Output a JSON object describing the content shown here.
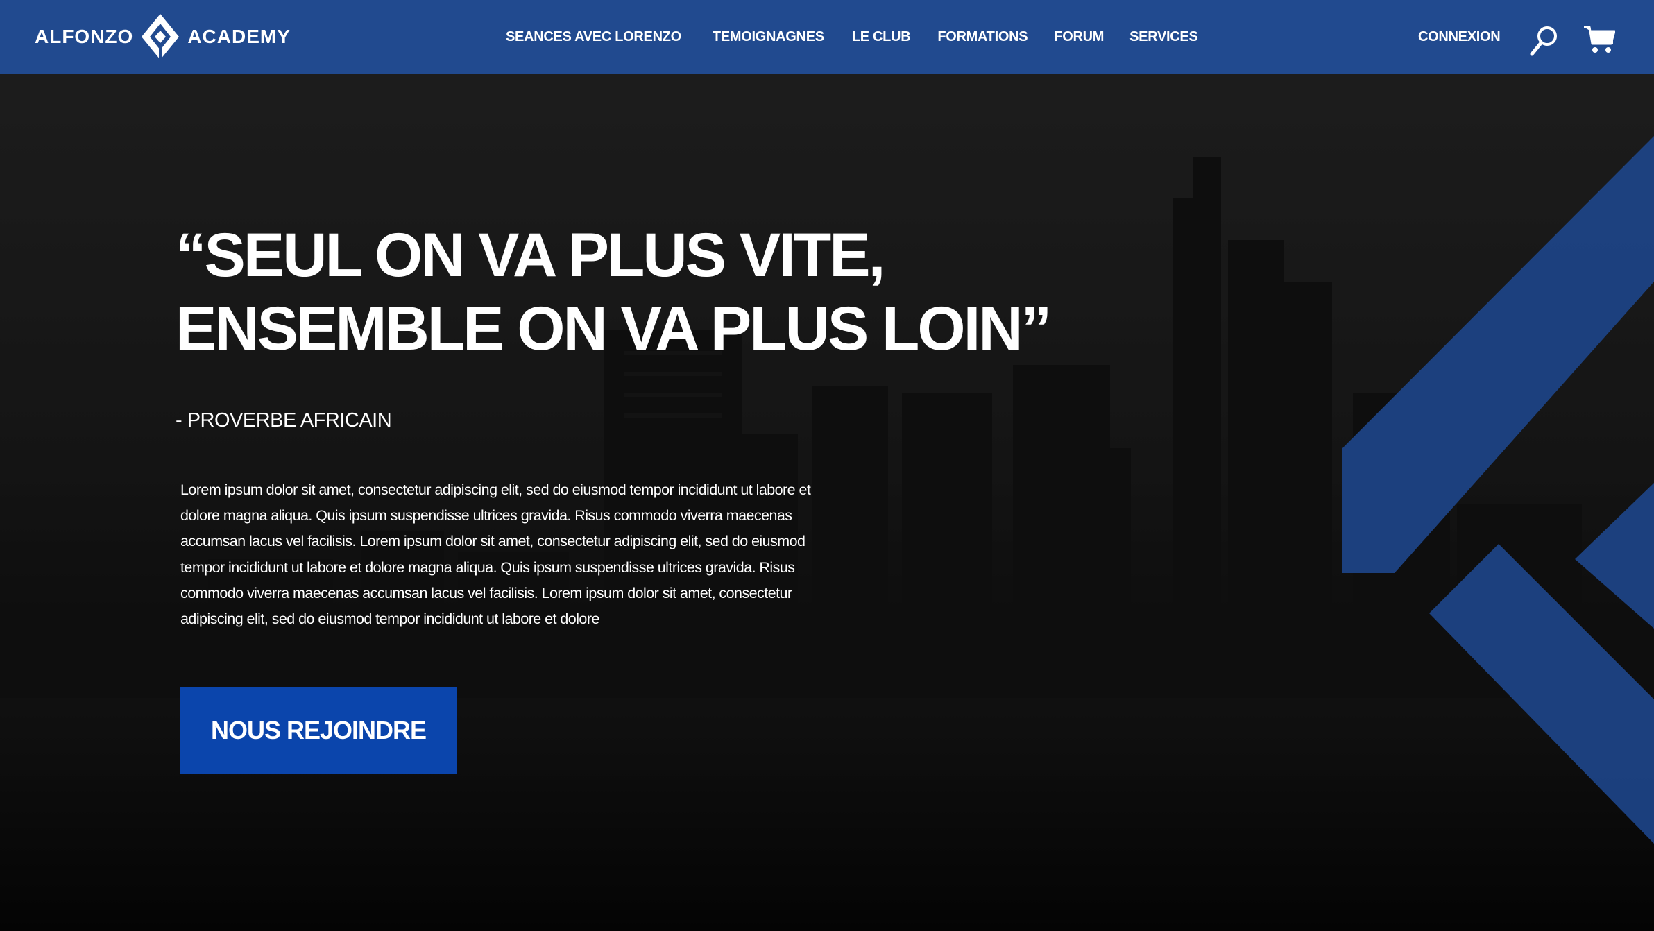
{
  "brand": {
    "name_left": "ALFONZO",
    "name_right": "ACADEMY",
    "logo_icon": "diamond-a-logo-icon"
  },
  "nav": {
    "links": [
      {
        "label": "SEANCES AVEC LORENZO"
      },
      {
        "label": "TEMOIGNAGNES"
      },
      {
        "label": "LE CLUB"
      },
      {
        "label": "FORMATIONS"
      },
      {
        "label": "FORUM"
      },
      {
        "label": "SERVICES"
      }
    ],
    "login_label": "CONNEXION",
    "search_icon": "search-icon",
    "cart_icon": "cart-icon"
  },
  "hero": {
    "quote_line1": "“SEUL ON VA PLUS VITE,",
    "quote_line2": "ENSEMBLE ON VA PLUS LOIN”",
    "attribution": "- PROVERBE AFRICAIN",
    "body": "Lorem ipsum dolor sit amet, consectetur adipiscing elit, sed do eiusmod tempor incididunt ut labore et dolore magna aliqua. Quis ipsum suspendisse ultrices gravida. Risus commodo viverra maecenas accumsan lacus vel facilisis.  Lorem ipsum dolor sit amet, consectetur adipiscing elit, sed do eiusmod tempor incididunt ut labore et dolore magna aliqua. Quis ipsum suspendisse ultrices gravida. Risus commodo viverra maecenas accumsan lacus vel facilisis.  Lorem ipsum dolor sit amet, consectetur adipiscing elit, sed do eiusmod tempor incididunt ut labore et dolore",
    "cta_label": "NOUS REJOINDRE"
  },
  "colors": {
    "header_bg": "#214a8f",
    "cta_bg": "#0b45ac",
    "accent_chevron": "#1d4488",
    "text": "#ffffff"
  }
}
